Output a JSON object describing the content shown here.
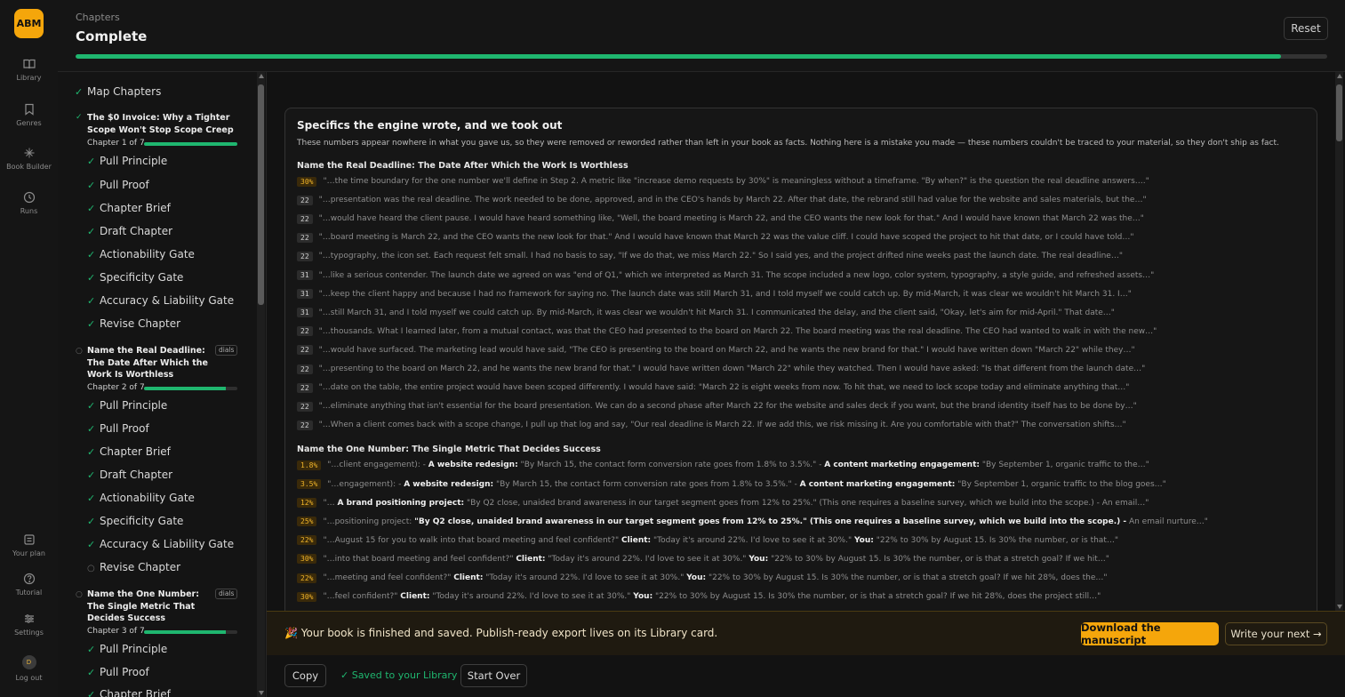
{
  "rail": {
    "logo": "ABM",
    "items": [
      {
        "label": "Library",
        "icon": "book-icon"
      },
      {
        "label": "Genres",
        "icon": "bookmark-icon"
      },
      {
        "label": "Book Builder",
        "icon": "sparkle-icon"
      },
      {
        "label": "Runs",
        "icon": "clock-icon"
      }
    ],
    "bottom_items": [
      {
        "label": "Your plan",
        "icon": "plan-icon"
      },
      {
        "label": "Tutorial",
        "icon": "help-icon"
      },
      {
        "label": "Settings",
        "icon": "sliders-icon"
      },
      {
        "label": "Log out",
        "avatar": "D"
      }
    ]
  },
  "header": {
    "breadcrumb": "Chapters",
    "title": "Complete",
    "reset_label": "Reset",
    "progress": 0.963
  },
  "sidebar": {
    "map_chapters": "Map Chapters",
    "chapters": [
      {
        "title": "The $0 Invoice: Why a Tighter Scope Won't Stop Scope Creep",
        "meta": "Chapter 1 of 7",
        "progress": 1.0,
        "steps": [
          "Pull Principle",
          "Pull Proof",
          "Chapter Brief",
          "Draft Chapter",
          "Actionability Gate",
          "Specificity Gate",
          "Accuracy & Liability Gate",
          "Revise Chapter"
        ]
      },
      {
        "title": "Name the Real Deadline: The Date After Which the Work Is Worthless",
        "meta": "Chapter 2 of 7",
        "badge": "dials",
        "progress": 0.88,
        "steps": [
          "Pull Principle",
          "Pull Proof",
          "Chapter Brief",
          "Draft Chapter",
          "Actionability Gate",
          "Specificity Gate",
          "Accuracy & Liability Gate",
          "Revise Chapter"
        ]
      },
      {
        "title": "Name the One Number: The Single Metric That Decides Success",
        "meta": "Chapter 3 of 7",
        "badge": "dials",
        "progress": 0.88,
        "steps": [
          "Pull Principle",
          "Pull Proof",
          "Chapter Brief"
        ]
      }
    ]
  },
  "card": {
    "heading": "Specifics the engine wrote, and we took out",
    "subtitle": "These numbers appear nowhere in what you gave us, so they were removed or reworded rather than left in your book as facts. Nothing here is a mistake you made — these numbers couldn't be traced to your material, so they don't ship as fact.",
    "sections": [
      {
        "heading": "Name the Real Deadline: The Date After Which the Work Is Worthless",
        "rows": [
          {
            "num": "30%",
            "tone": "amber",
            "text": "\"…the time boundary for the one number we'll define in Step 2. A metric like \"increase demo requests by 30%\" is meaningless without a timeframe. \"By when?\" is the question the real deadline answers….\""
          },
          {
            "num": "22",
            "tone": "gray",
            "text": "\"…presentation was the real deadline. The work needed to be done, approved, and in the CEO's hands by March 22. After that date, the rebrand still had value for the website and sales materials, but the…\""
          },
          {
            "num": "22",
            "tone": "gray",
            "text": "\"…would have heard the client pause. I would have heard something like, \"Well, the board meeting is March 22, and the CEO wants the new look for that.\" And I would have known that March 22 was the…\""
          },
          {
            "num": "22",
            "tone": "gray",
            "text": "\"…board meeting is March 22, and the CEO wants the new look for that.\" And I would have known that March 22 was the value cliff. I could have scoped the project to hit that date, or I could have told…\""
          },
          {
            "num": "22",
            "tone": "gray",
            "text": "\"…typography, the icon set. Each request felt small. I had no basis to say, \"If we do that, we miss March 22.\" So I said yes, and the project drifted nine weeks past the launch date. The real deadline…\""
          },
          {
            "num": "31",
            "tone": "gray",
            "text": "\"…like a serious contender. The launch date we agreed on was \"end of Q1,\" which we interpreted as March 31. The scope included a new logo, color system, typography, a style guide, and refreshed assets…\""
          },
          {
            "num": "31",
            "tone": "gray",
            "text": "\"…keep the client happy and because I had no framework for saying no. The launch date was still March 31, and I told myself we could catch up. By mid-March, it was clear we wouldn't hit March 31. I…\""
          },
          {
            "num": "31",
            "tone": "gray",
            "text": "\"…still March 31, and I told myself we could catch up. By mid-March, it was clear we wouldn't hit March 31. I communicated the delay, and the client said, \"Okay, let's aim for mid-April.\" That date…\""
          },
          {
            "num": "22",
            "tone": "gray",
            "text": "\"…thousands. What I learned later, from a mutual contact, was that the CEO had presented to the board on March 22. The board meeting was the real deadline. The CEO had wanted to walk in with the new…\""
          },
          {
            "num": "22",
            "tone": "gray",
            "text": "\"…would have surfaced. The marketing lead would have said, \"The CEO is presenting to the board on March 22, and he wants the new brand for that.\" I would have written down \"March 22\" while they…\""
          },
          {
            "num": "22",
            "tone": "gray",
            "text": "\"…presenting to the board on March 22, and he wants the new brand for that.\" I would have written down \"March 22\" while they watched. Then I would have asked: \"Is that different from the launch date…\""
          },
          {
            "num": "22",
            "tone": "gray",
            "text": "\"…date on the table, the entire project would have been scoped differently. I would have said: \"March 22 is eight weeks from now. To hit that, we need to lock scope today and eliminate anything that…\""
          },
          {
            "num": "22",
            "tone": "gray",
            "text": "\"…eliminate anything that isn't essential for the board presentation. We can do a second phase after March 22 for the website and sales deck if you want, but the brand identity itself has to be done by…\""
          },
          {
            "num": "22",
            "tone": "gray",
            "text": "\"…When a client comes back with a scope change, I pull up that log and say, \"Our real deadline is March 22. If we add this, we risk missing it. Are you comfortable with that?\" The conversation shifts…\""
          }
        ]
      },
      {
        "heading": "Name the One Number: The Single Metric That Decides Success",
        "rows": [
          {
            "num": "1.8%",
            "tone": "amber",
            "parts": [
              {
                "t": "\"…client engagement): - "
              },
              {
                "t": "A website redesign:",
                "b": true
              },
              {
                "t": " \"By March 15, the contact form conversion rate goes from 1.8% to 3.5%.\" - "
              },
              {
                "t": "A content marketing engagement:",
                "b": true
              },
              {
                "t": " \"By September 1, organic traffic to the…\""
              }
            ]
          },
          {
            "num": "3.5%",
            "tone": "amber",
            "parts": [
              {
                "t": "\"…engagement): - "
              },
              {
                "t": "A website redesign:",
                "b": true
              },
              {
                "t": " \"By March 15, the contact form conversion rate goes from 1.8% to 3.5%.\" - "
              },
              {
                "t": "A content marketing engagement:",
                "b": true
              },
              {
                "t": " \"By September 1, organic traffic to the blog goes…\""
              }
            ]
          },
          {
            "num": "12%",
            "tone": "amber",
            "parts": [
              {
                "t": "\"… "
              },
              {
                "t": "A brand positioning project:",
                "b": true
              },
              {
                "t": " \"By Q2 close, unaided brand awareness in our target segment goes from 12% to 25%.\" (This one requires a baseline survey, which we build into the scope.) - An email…\""
              }
            ]
          },
          {
            "num": "25%",
            "tone": "amber",
            "parts": [
              {
                "t": "\"…positioning project: "
              },
              {
                "t": "\"By Q2 close, unaided brand awareness in our target segment goes from 12% to 25%.\" (This one requires a baseline survey, which we build into the scope.) -",
                "b": true
              },
              {
                "t": " An email nurture…\""
              }
            ]
          },
          {
            "num": "22%",
            "tone": "amber",
            "parts": [
              {
                "t": "\"…August 15 for you to walk into that board meeting and feel confident?\" "
              },
              {
                "t": "Client:",
                "b": true
              },
              {
                "t": " \"Today it's around 22%. I'd love to see it at 30%.\" "
              },
              {
                "t": "You:",
                "b": true
              },
              {
                "t": " \"22% to 30% by August 15. Is 30% the number, or is that…\""
              }
            ]
          },
          {
            "num": "30%",
            "tone": "amber",
            "parts": [
              {
                "t": "\"…into that board meeting and feel confident?\" "
              },
              {
                "t": "Client:",
                "b": true
              },
              {
                "t": " \"Today it's around 22%. I'd love to see it at 30%.\" "
              },
              {
                "t": "You:",
                "b": true
              },
              {
                "t": " \"22% to 30% by August 15. Is 30% the number, or is that a stretch goal? If we hit…\""
              }
            ]
          },
          {
            "num": "22%",
            "tone": "amber",
            "parts": [
              {
                "t": "\"…meeting and feel confident?\" "
              },
              {
                "t": "Client:",
                "b": true
              },
              {
                "t": " \"Today it's around 22%. I'd love to see it at 30%.\" "
              },
              {
                "t": "You:",
                "b": true
              },
              {
                "t": " \"22% to 30% by August 15. Is 30% the number, or is that a stretch goal? If we hit 28%, does the…\""
              }
            ]
          },
          {
            "num": "30%",
            "tone": "amber",
            "parts": [
              {
                "t": "\"…feel confident?\" "
              },
              {
                "t": "Client:",
                "b": true
              },
              {
                "t": " \"Today it's around 22%. I'd love to see it at 30%.\" "
              },
              {
                "t": "You:",
                "b": true
              },
              {
                "t": " \"22% to 30% by August 15. Is 30% the number, or is that a stretch goal? If we hit 28%, does the project still…\""
              }
            ]
          }
        ]
      }
    ]
  },
  "finish": {
    "message": "🎉 Your book is finished and saved. Publish-ready export lives on its Library card.",
    "download_label": "Download the manuscript",
    "next_label": "Write your next →"
  },
  "bottom": {
    "copy_label": "Copy",
    "saved_label": "✓ Saved to your Library",
    "start_over_label": "Start Over"
  },
  "colors": {
    "accent": "#f5a60b",
    "success": "#1fb66f",
    "background": "#121212"
  }
}
